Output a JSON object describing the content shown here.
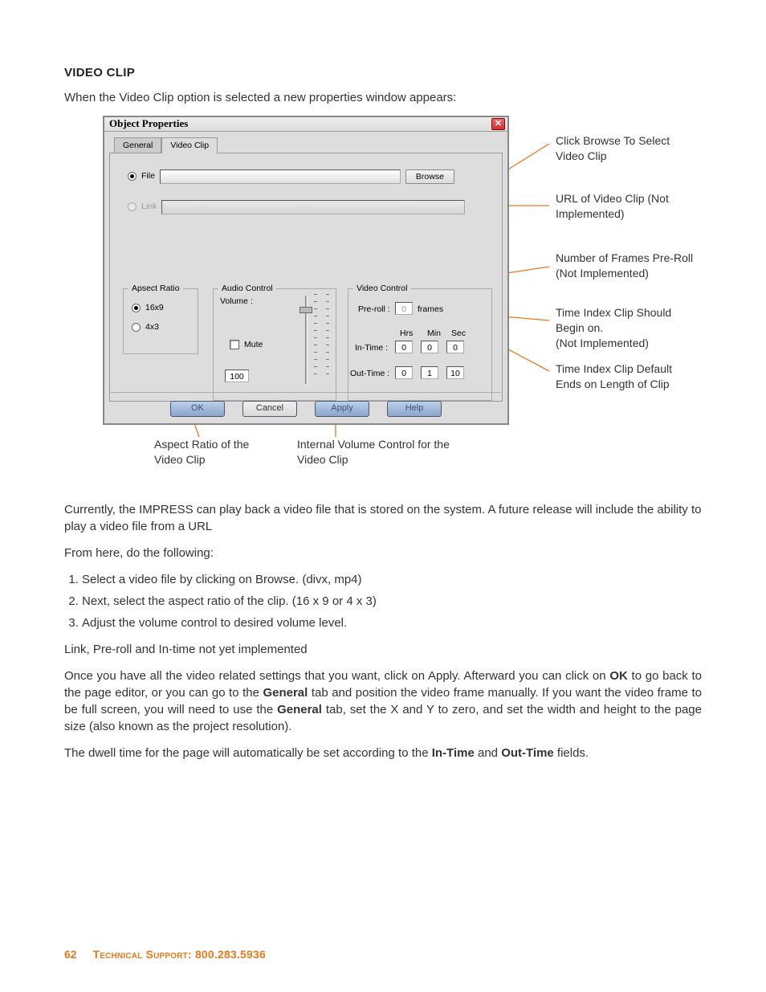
{
  "heading": "VIDEO CLIP",
  "intro": "When the Video Clip option is selected a new properties window appears:",
  "dialog": {
    "title": "Object Properties",
    "tabs": {
      "general": "General",
      "videoclip": "Video Clip"
    },
    "source": {
      "file_label": "File",
      "link_label": "Link",
      "browse": "Browse"
    },
    "aspect": {
      "legend": "Apsect Ratio",
      "opt1": "16x9",
      "opt2": "4x3"
    },
    "audio": {
      "legend": "Audio Control",
      "volume_label": "Volume :",
      "mute": "Mute",
      "value": "100"
    },
    "video": {
      "legend": "Video Control",
      "preroll_label": "Pre-roll :",
      "preroll_value": "0",
      "frames": "frames",
      "hrs": "Hrs",
      "min": "Min",
      "sec": "Sec",
      "intime_label": "In-Time :",
      "in_h": "0",
      "in_m": "0",
      "in_s": "0",
      "outtime_label": "Out-Time :",
      "out_h": "0",
      "out_m": "1",
      "out_s": "10"
    },
    "buttons": {
      "ok": "OK",
      "cancel": "Cancel",
      "apply": "Apply",
      "help": "Help"
    }
  },
  "callouts": {
    "browse": "Click Browse To Select Video Clip",
    "url": "URL of Video Clip (Not Implemented)",
    "preroll": "Number of Frames Pre-Roll\n(Not Implemented)",
    "intime": "Time Index Clip Should Begin on.\n(Not Implemented)",
    "outtime": "Time Index Clip Default Ends on Length of Clip",
    "aspect": "Aspect Ratio of the Video Clip",
    "volume": "Internal Volume Control for the Video Clip"
  },
  "body": {
    "p1_a": "Currently, the IMPRESS can play back a video file that is stored on the system.  A future release will include the ability to play a video file from a URL",
    "p2": "From here, do the following:",
    "s1_a": "Select a video file by clicking on ",
    "s1_b": "Browse",
    "s1_c": ". (divx, mp4)",
    "s2": "Next, select the aspect ratio of the clip.  (16 x 9 or 4 x 3)",
    "s3": "Adjust the volume control to desired volume level.",
    "p3": "Link, Pre-roll and In-time not yet implemented",
    "p4_a": "Once you have all the video related settings that you want, click on Apply. Afterward you can click on ",
    "p4_b": "OK",
    "p4_c": " to go back to the page editor, or you can go to the ",
    "p4_d": "General",
    "p4_e": " tab and position the video frame manually.  If you want the video frame to be full screen, you will need to use the ",
    "p4_f": "General",
    "p4_g": " tab, set the X and Y to zero, and set the width and height to the page size (also known as the project resolution).",
    "p5_a": "The dwell time for the page will automatically be set according to the ",
    "p5_b": "In-Time",
    "p5_c": " and ",
    "p5_d": "Out-Time",
    "p5_e": " fields."
  },
  "footer": {
    "page": "62",
    "support_label": "Technical Support",
    "support_sep": ": ",
    "support_num": "800.283.5936"
  }
}
